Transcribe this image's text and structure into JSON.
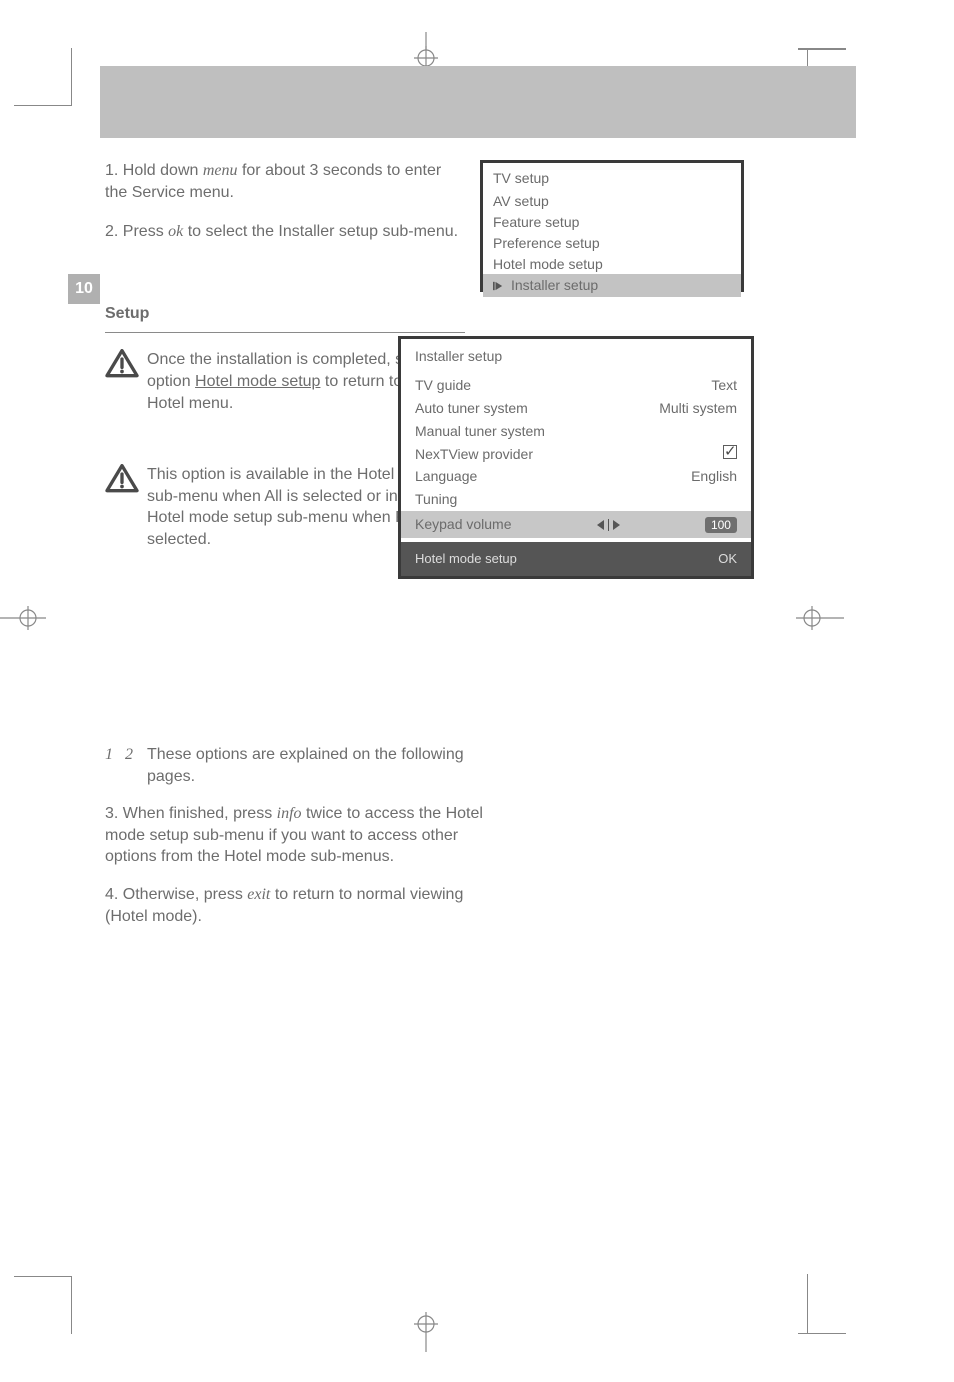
{
  "pageNumber": "10",
  "headerText": "",
  "leftCol": {
    "p1a": "1. Hold down ",
    "p1_menu": "menu",
    "p1b": " for about 3 seconds to enter the Service menu.",
    "p2a": "2. Press ",
    "p2_ok": "ok",
    "p2b": " to select the Installer setup sub-menu.",
    "note1a": "Once the installation is completed, select the option",
    "note1b": "Hotel mode setup",
    "note1c": " to return to the Hotel menu.",
    "note2": "This option is available in the Hotel mode sub-menu when All is selected or in the Hotel mode setup sub-menu when Part is selected.",
    "h_setup": "Setup"
  },
  "osd1": {
    "title": "TV setup",
    "items": [
      "AV setup",
      "Feature setup",
      "Preference setup",
      "Hotel mode setup"
    ],
    "highlight": "Installer setup"
  },
  "osd2": {
    "title": "Installer setup",
    "rows": [
      {
        "label": "TV guide",
        "value": "Text"
      },
      {
        "label": "Auto tuner system",
        "value": "Multi system"
      },
      {
        "label": "Manual tuner system"
      },
      {
        "label": "NexTView provider",
        "value_icon": "checked"
      },
      {
        "label": "Language",
        "value": "English"
      },
      {
        "label": "Tuning"
      }
    ],
    "volumeRow": {
      "label": "Keypad volume",
      "value": "100"
    },
    "footer": {
      "left": "Hotel mode setup",
      "right": "OK"
    }
  },
  "section2": {
    "line1_steps": [
      "1",
      "2"
    ],
    "line1_rest": " These options are explained on the following pages.",
    "p1a": "3. When finished, press ",
    "p1_info": "info",
    "p1b": " twice to access the Hotel mode setup sub-menu if you want to access other options from the Hotel mode sub-menus.",
    "p2a": "4. Otherwise, press ",
    "p2_exit": "exit",
    "p2b": " to return to normal viewing (Hotel mode)."
  }
}
